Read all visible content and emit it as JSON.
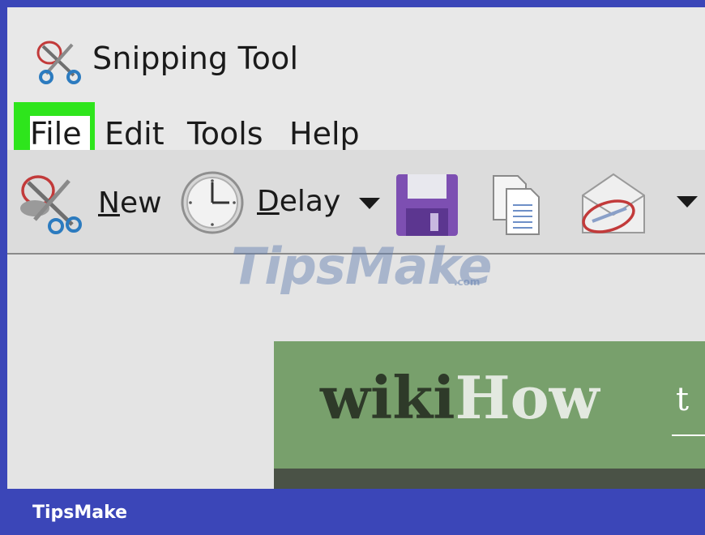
{
  "window": {
    "title": "Snipping Tool",
    "icon": "scissors-icon"
  },
  "menu": {
    "items": [
      {
        "label": "File",
        "highlighted": true
      },
      {
        "label": "Edit"
      },
      {
        "label": "Tools"
      },
      {
        "label": "Help"
      }
    ],
    "highlight_color": "#2ee51c"
  },
  "toolbar": {
    "new": {
      "label": "New",
      "icon": "scissors-icon"
    },
    "delay": {
      "label": "Delay",
      "icon": "clock-icon"
    },
    "save": {
      "icon": "floppy-disk-icon"
    },
    "copy": {
      "icon": "copy-icon"
    },
    "send": {
      "icon": "envelope-icon"
    }
  },
  "content": {
    "watermark": "TipsMake",
    "watermark_suffix": ".com",
    "banner": {
      "logo_dark": "wiki",
      "logo_light": "How",
      "tagline_fragment": "t"
    }
  },
  "footer": {
    "brand": "TipsMake"
  },
  "colors": {
    "frame_border": "#3b46b8",
    "banner_green": "#78a06c"
  }
}
